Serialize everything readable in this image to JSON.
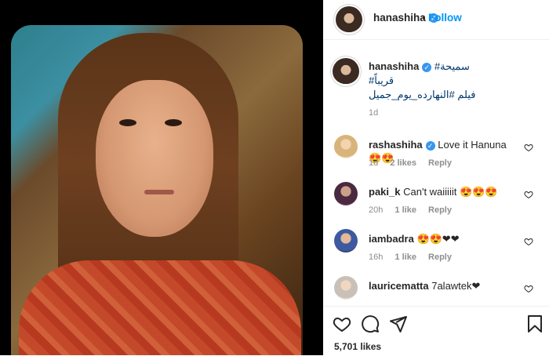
{
  "post": {
    "author": "hanashiha",
    "follow_label": "Follow",
    "separator": "•",
    "verified_mark": "✓",
    "caption_line1_tag": "سميحة#",
    "caption_line2": "قريباً#",
    "caption_line3": "فيلم #النهارده_يوم_جميل",
    "caption_time": "1d",
    "likes": "5,701 likes"
  },
  "comments": [
    {
      "user": "rashashiha",
      "verified": true,
      "text": "Love it Hanuna😍😍",
      "time": "1d",
      "likes": "2 likes",
      "reply": "Reply"
    },
    {
      "user": "paki_k",
      "verified": false,
      "text": "Can't waiiiiit 😍😍😍",
      "time": "20h",
      "likes": "1 like",
      "reply": "Reply"
    },
    {
      "user": "iambadra",
      "verified": false,
      "text": "😍😍❤❤",
      "time": "16h",
      "likes": "1 like",
      "reply": "Reply"
    },
    {
      "user": "lauricematta",
      "verified": false,
      "text": "7alawtek❤",
      "time": "",
      "likes": "",
      "reply": ""
    }
  ],
  "icons": {
    "like": "heart-icon",
    "comment": "comment-icon",
    "share": "share-icon",
    "save": "bookmark-icon"
  },
  "colors": {
    "accent": "#0095f6",
    "verified": "#3897f0",
    "muted": "#8e8e8e"
  }
}
